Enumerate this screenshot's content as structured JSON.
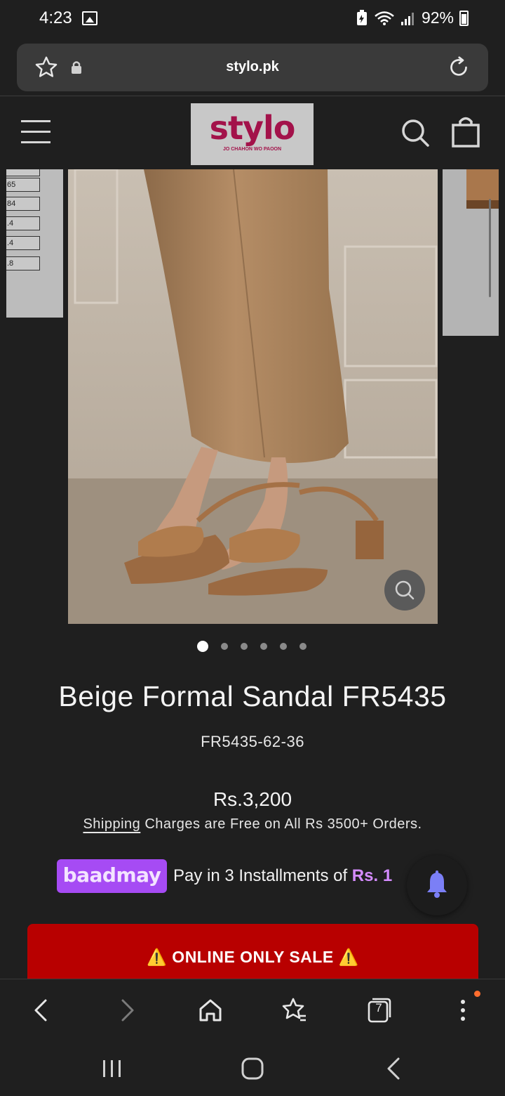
{
  "status_bar": {
    "time": "4:23",
    "battery": "92%"
  },
  "browser": {
    "url": "stylo.pk",
    "tab_count": "7"
  },
  "site": {
    "logo_text": "stylo",
    "logo_tagline": "JO CHAHON WO PAOON",
    "brand_color": "#a3124a"
  },
  "gallery": {
    "size_chart_values": [
      "65",
      "84",
      ".4",
      ".4",
      ".8"
    ],
    "slide_count": 6,
    "active_slide": 1
  },
  "product": {
    "title": "Beige Formal Sandal FR5435",
    "sku": "FR5435-62-36",
    "price": "Rs.3,200",
    "shipping_link": "Shipping",
    "shipping_rest": " Charges are Free on All Rs 3500+ Orders."
  },
  "baadmay": {
    "logo": "baadmay",
    "text": "Pay in 3 Installments of ",
    "amount": "Rs. 1"
  },
  "banner": {
    "text": "⚠️ ONLINE ONLY SALE ⚠️",
    "color": "#b80000"
  },
  "icons": {
    "toolbar": [
      "back-icon",
      "forward-icon",
      "home-icon",
      "bookmarks-icon",
      "tabs-icon",
      "menu-icon"
    ],
    "nav": [
      "recents-icon",
      "home-nav-icon",
      "back-nav-icon"
    ]
  }
}
